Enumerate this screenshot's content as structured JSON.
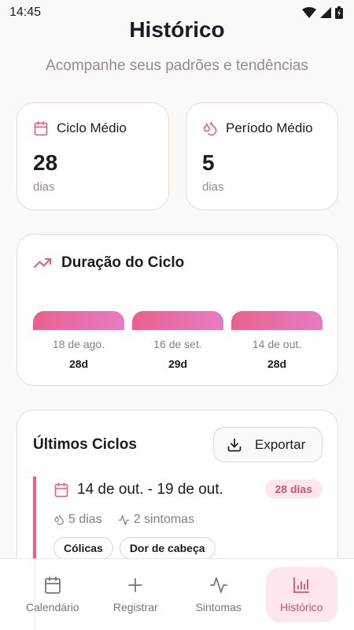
{
  "status_bar": {
    "time": "14:45"
  },
  "header": {
    "title": "Histórico",
    "subtitle": "Acompanhe seus padrões e tendências"
  },
  "stats": {
    "cycle": {
      "label": "Ciclo Médio",
      "value": "28",
      "unit": "dias"
    },
    "period": {
      "label": "Período Médio",
      "value": "5",
      "unit": "dias"
    }
  },
  "chart": {
    "title": "Duração do Ciclo",
    "accent_start": "#e8618c",
    "accent_end": "#e77cc4"
  },
  "chart_data": {
    "type": "bar",
    "title": "Duração do Ciclo",
    "categories": [
      "18 de ago.",
      "16 de set.",
      "14 de out."
    ],
    "values": [
      28,
      29,
      28
    ],
    "value_labels": [
      "28d",
      "29d",
      "28d"
    ]
  },
  "cycles": {
    "title": "Últimos Ciclos",
    "export_label": "Exportar",
    "items": [
      {
        "range": "14 de out. - 19 de out.",
        "badge": "28 dias",
        "period": "5 dias",
        "symptoms": "2 sintomas",
        "tags": [
          "Cólicas",
          "Dor de cabeça"
        ]
      }
    ]
  },
  "nav": {
    "items": [
      {
        "label": "Calendário",
        "icon": "calendar-icon"
      },
      {
        "label": "Registrar",
        "icon": "plus-icon"
      },
      {
        "label": "Sintomas",
        "icon": "activity-icon"
      },
      {
        "label": "Histórico",
        "icon": "bar-chart-icon",
        "active": true
      }
    ]
  }
}
